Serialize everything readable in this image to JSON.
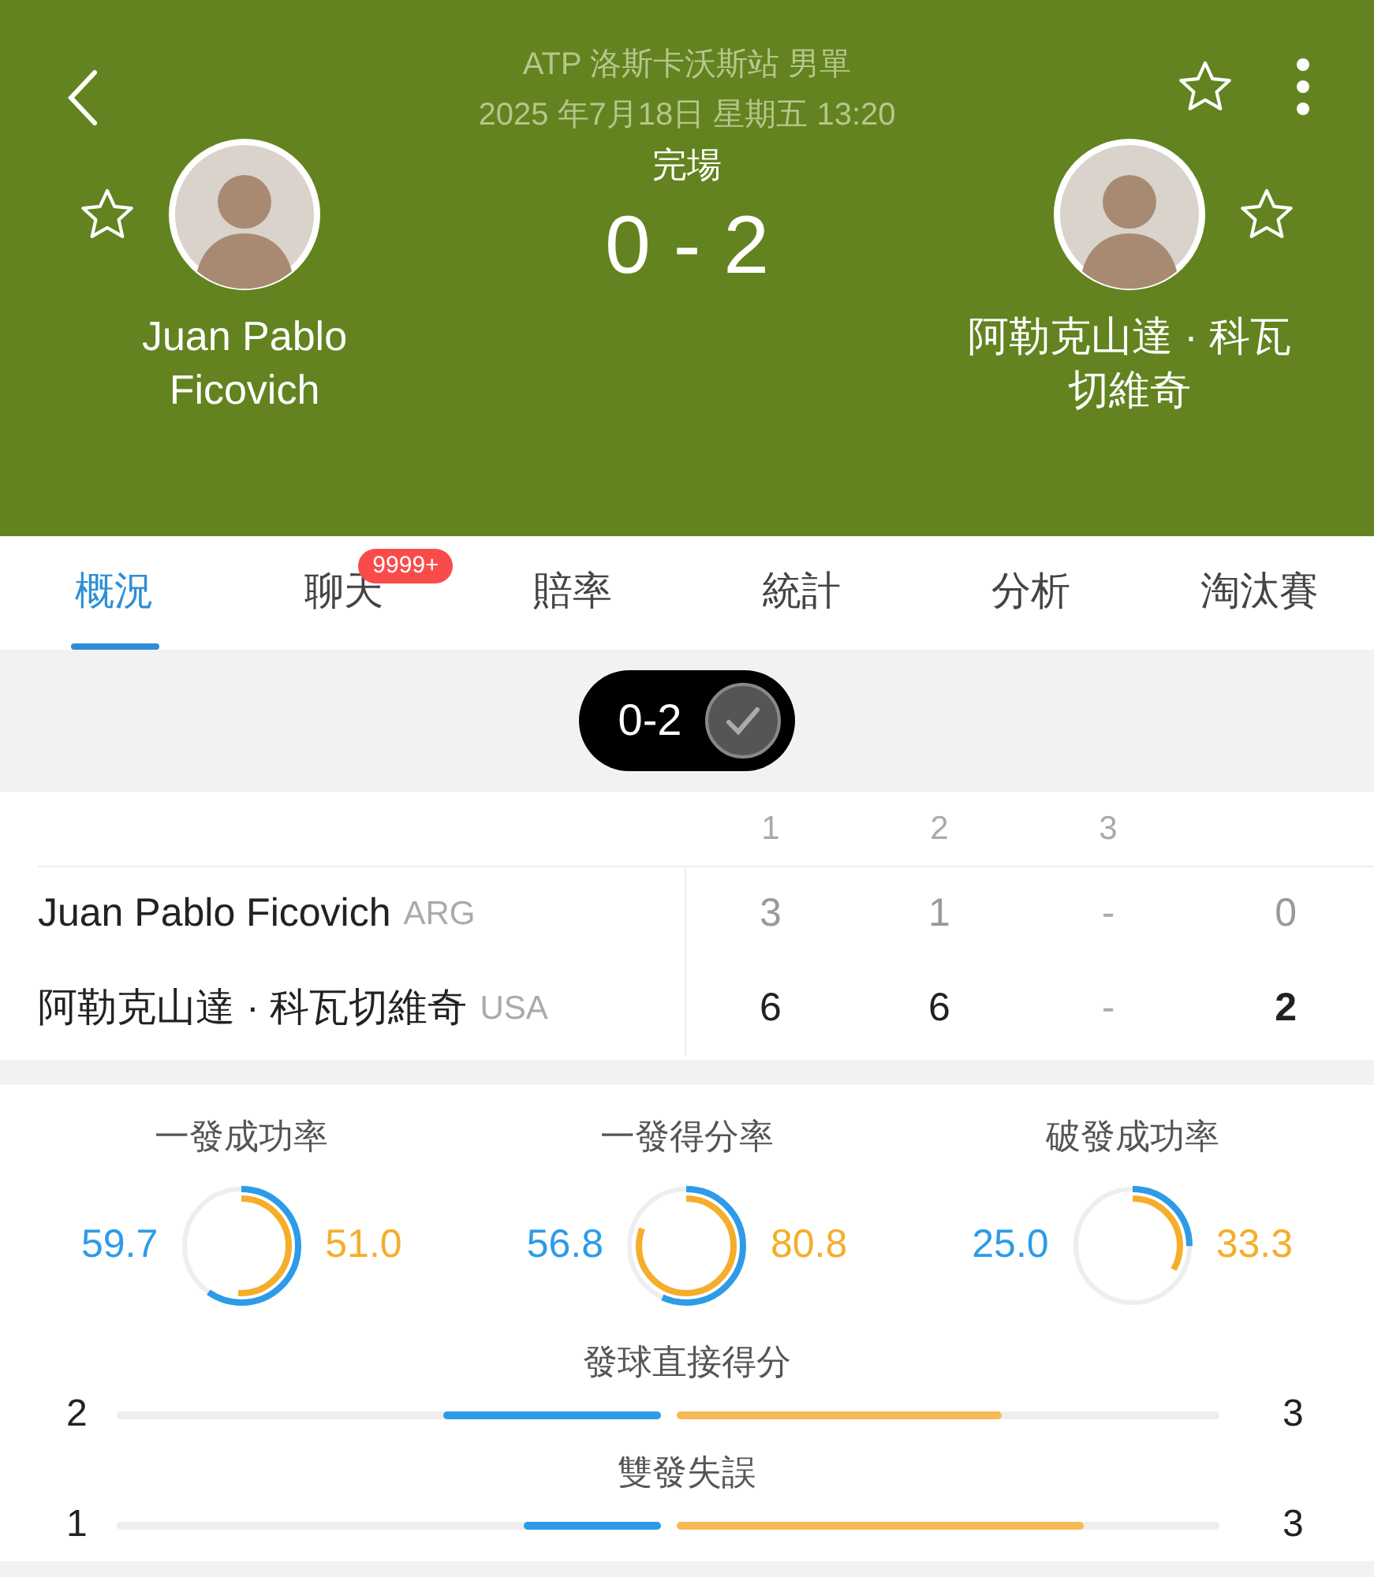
{
  "header": {
    "title": "ATP 洛斯卡沃斯站 男單",
    "datetime": "2025 年7月18日 星期五 13:20",
    "favorite": false,
    "status": "完場",
    "score": "0 - 2",
    "players": [
      {
        "name": "Juan Pablo Ficovich",
        "favorite": false
      },
      {
        "name": "阿勒克山達 · 科瓦切維奇",
        "favorite": false
      }
    ]
  },
  "tabs": [
    {
      "label": "概況",
      "selected": true
    },
    {
      "label": "聊天",
      "selected": false,
      "badge": "9999+"
    },
    {
      "label": "賠率",
      "selected": false
    },
    {
      "label": "統計",
      "selected": false
    },
    {
      "label": "分析",
      "selected": false
    },
    {
      "label": "淘汰賽",
      "selected": false
    }
  ],
  "result_pill": {
    "score": "0-2"
  },
  "scoreboard": {
    "columns": [
      "1",
      "2",
      "3"
    ],
    "rows": [
      {
        "name": "Juan Pablo Ficovich",
        "country": "ARG",
        "sets": [
          "3",
          "1",
          "-"
        ],
        "total": "0",
        "winner": false
      },
      {
        "name": "阿勒克山達 · 科瓦切維奇",
        "country": "USA",
        "sets": [
          "6",
          "6",
          "-"
        ],
        "total": "2",
        "winner": true
      }
    ]
  },
  "rings": [
    {
      "label": "一發成功率",
      "home": {
        "value": "59.7",
        "level": 0.597
      },
      "away": {
        "value": "51.0",
        "level": 0.51
      }
    },
    {
      "label": "一發得分率",
      "home": {
        "value": "56.8",
        "level": 0.568
      },
      "away": {
        "value": "80.8",
        "level": 0.808
      }
    },
    {
      "label": "破發成功率",
      "home": {
        "value": "25.0",
        "level": 0.25
      },
      "away": {
        "value": "33.3",
        "level": 0.333
      }
    }
  ],
  "bars": [
    {
      "label": "發球直接得分",
      "home": {
        "value": "2",
        "level": 0.4
      },
      "away": {
        "value": "3",
        "level": 0.6
      }
    },
    {
      "label": "雙發失誤",
      "home": {
        "value": "1",
        "level": 0.25
      },
      "away": {
        "value": "3",
        "level": 0.75
      }
    }
  ]
}
